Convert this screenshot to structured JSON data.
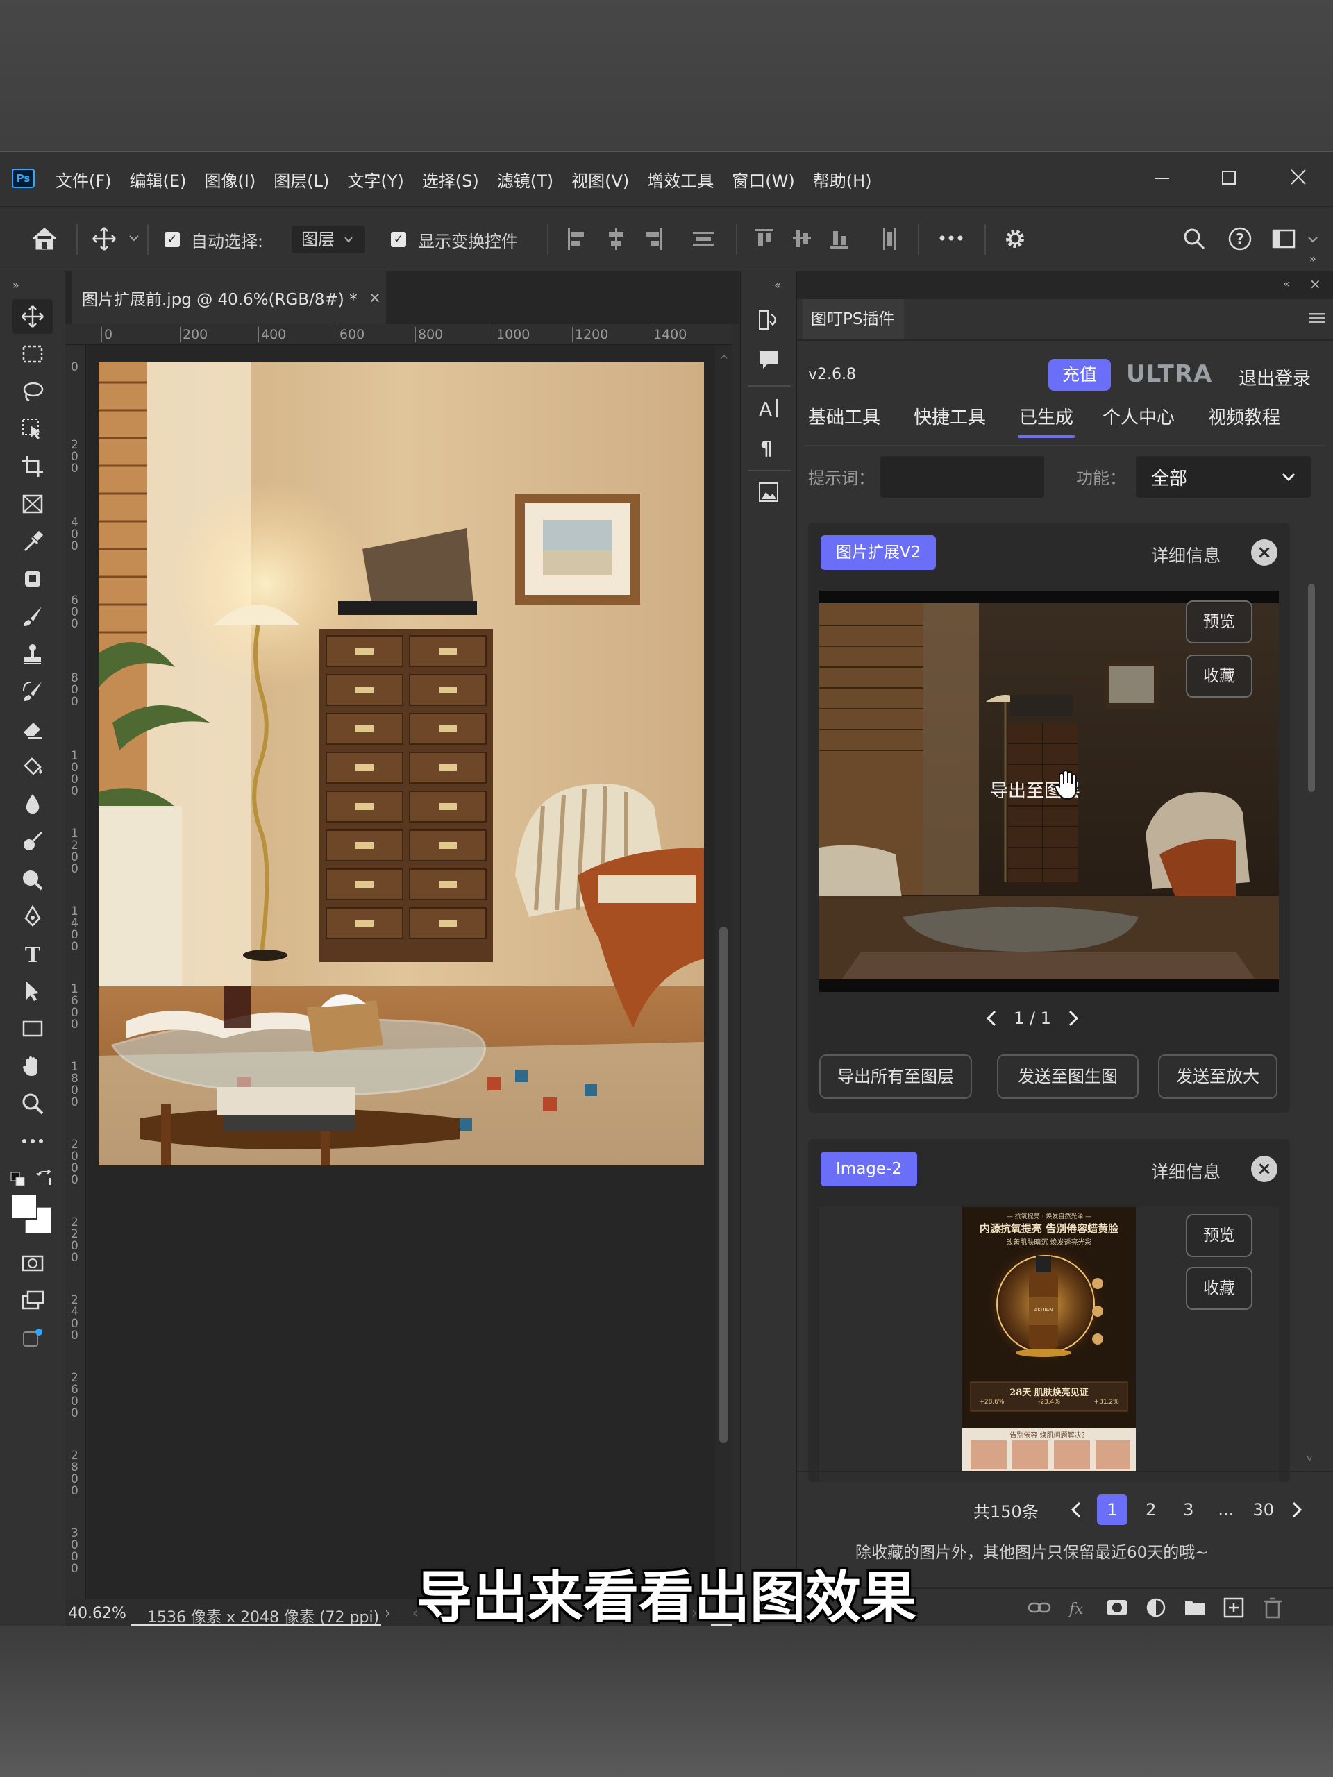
{
  "app": {
    "logo": "Ps",
    "icon": "photoshop-logo"
  },
  "menu": [
    "文件(F)",
    "编辑(E)",
    "图像(I)",
    "图层(L)",
    "文字(Y)",
    "选择(S)",
    "滤镜(T)",
    "视图(V)",
    "增效工具",
    "窗口(W)",
    "帮助(H)"
  ],
  "options_bar": {
    "auto_select_label": "自动选择:",
    "auto_select_value": "图层",
    "show_transform_label": "显示变换控件",
    "auto_select_checked": true,
    "show_transform_checked": true
  },
  "document": {
    "tab_title": "图片扩展前.jpg @ 40.6%(RGB/8#) *",
    "ruler_h": [
      "0",
      "200",
      "400",
      "600",
      "800",
      "1000",
      "1200",
      "1400"
    ],
    "ruler_v": [
      "0",
      "200",
      "400",
      "600",
      "800",
      "1000",
      "1200",
      "1400",
      "1600",
      "1800",
      "2000",
      "2200",
      "2400",
      "2600",
      "2800",
      "3000"
    ],
    "zoom": "40.62%",
    "info": "1536 像素 x 2048 像素 (72 ppi)"
  },
  "plugin": {
    "panel_title": "图叮PS插件",
    "version": "v2.6.8",
    "recharge": "充值",
    "ultra": "ULTRA",
    "logout": "退出登录",
    "tabs": [
      "基础工具",
      "快捷工具",
      "已生成",
      "个人中心",
      "视频教程"
    ],
    "active_tab_index": 2,
    "prompt_label": "提示词：",
    "prompt_value": "",
    "func_label": "功能：",
    "func_value": "全部",
    "cards": [
      {
        "badge": "图片扩展V2",
        "details": "详细信息",
        "preview": "预览",
        "favorite": "收藏",
        "hover_text": "导出至图层",
        "pager": "1 / 1",
        "actions": [
          "导出所有至图层",
          "发送至图生图",
          "发送至放大"
        ]
      },
      {
        "badge": "Image-2",
        "details": "详细信息",
        "preview": "预览",
        "favorite": "收藏",
        "poster": {
          "tag": "— 抗氧提亮 · 焕发自然光泽 —",
          "headline": "内源抗氧提亮 告别倦容蜡黄脸",
          "sub": "改善肌肤暗沉 焕发透亮光彩",
          "bottle": "AKDIAN",
          "stat": "28天 肌肤焕亮见证",
          "nums": [
            "+28.6%",
            "-23.4%",
            "+31.2%"
          ],
          "caption": "告别倦容 焕肌问题解决？"
        }
      }
    ],
    "pagination": {
      "total": "共150条",
      "pages": [
        "1",
        "2",
        "3",
        "...",
        "30"
      ],
      "active": "1"
    },
    "note": "除收藏的图片外，其他图片只保留最近60天的哦~"
  },
  "subtitle": "导出来看看出图效果",
  "colors": {
    "accent": "#6b6ef6",
    "ps_blue": "#31a8ff",
    "panel_bg": "#323232"
  }
}
